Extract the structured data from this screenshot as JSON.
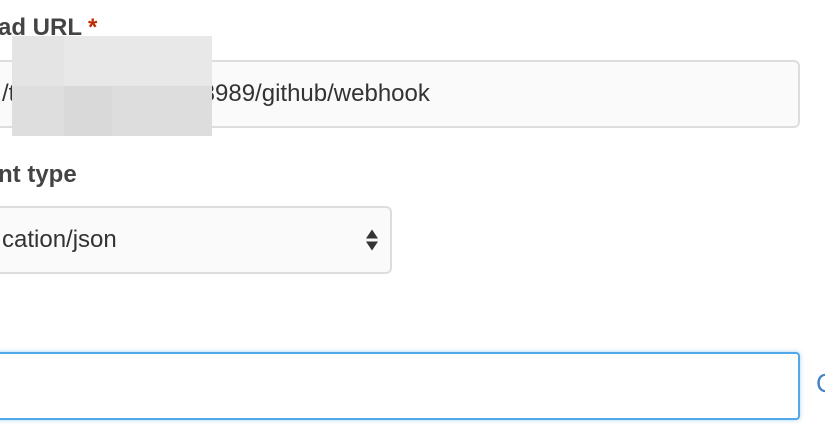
{
  "form": {
    "payload_url": {
      "label": "ad URL",
      "required_mark": "*",
      "value_left": "/t",
      "value_right": ":8989/github/webhook"
    },
    "content_type": {
      "label": "nt type",
      "selected": "cation/json",
      "arrows_icon": "select-updown-arrows-icon"
    },
    "secret": {
      "value": "",
      "state": "focused"
    },
    "edge_link": {
      "text": "C"
    }
  },
  "colors": {
    "required": "#bd2c00",
    "focus_border": "#51a7e8",
    "link": "#4183c4",
    "field_border": "#dddddd",
    "field_bg": "#fafafa"
  }
}
